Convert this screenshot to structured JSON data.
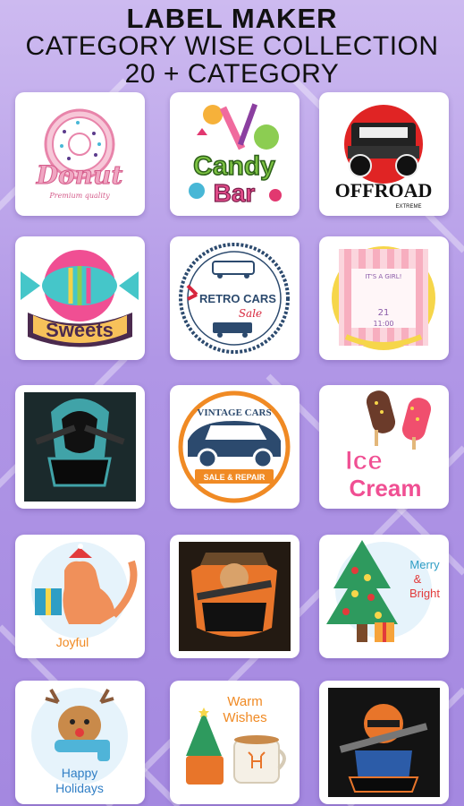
{
  "header": {
    "line1": "LABEL MAKER",
    "line2": "CATEGORY WISE COLLECTION",
    "line3": "20 + CATEGORY"
  },
  "colors": {
    "background": "#b59ce8",
    "tile": "#ffffff",
    "accent": "#e7407f"
  },
  "labels": {
    "donut": {
      "title": "Donut",
      "sub": "Premium quality"
    },
    "candy": {
      "line1": "Candy",
      "line2": "Bar"
    },
    "offroad": {
      "title": "OFFROAD",
      "sub": "EXTREME"
    },
    "sweets": {
      "title": "Sweets"
    },
    "retro_cars": {
      "line1": "RETRO CARS",
      "line2": "Sale"
    },
    "girl": {
      "top": "IT'S A GIRL!",
      "num": "21",
      "time": "11:00"
    },
    "vintage_cars": {
      "top": "VINTAGE CARS",
      "bottom": "SALE & REPAIR"
    },
    "ice_cream": {
      "line1": "Ice",
      "line2": "Cream"
    },
    "joyful": {
      "title": "Joyful"
    },
    "merry": {
      "line1": "Merry",
      "line2": "&",
      "line3": "Bright"
    },
    "happy": {
      "line1": "Happy",
      "line2": "Holidays"
    },
    "warm": {
      "line1": "Warm",
      "line2": "Wishes"
    }
  },
  "icons": [
    "gamer-mascot-icon",
    "hunter-mascot-icon",
    "soldier-mascot-icon"
  ]
}
